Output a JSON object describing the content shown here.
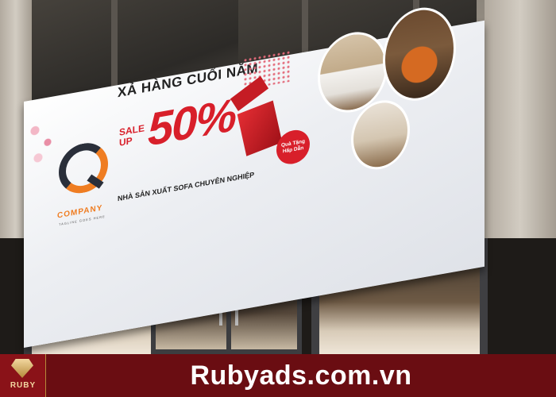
{
  "sign": {
    "headline": "XẢ HÀNG CUỐI NĂM",
    "sale_line1": "SALE",
    "sale_line2": "UP",
    "percent": "50%",
    "subline": "NHÀ SẢN XUẤT SOFA CHUYÊN NGHIỆP",
    "badge_line1": "Quà Tặng",
    "badge_line2": "Hấp Dẫn",
    "company": "COMPANY",
    "tagline": "TAGLINE GOES HERE"
  },
  "footer": {
    "brand": "RUBY",
    "domain": "Rubyads.com.vn"
  },
  "colors": {
    "accent_red": "#d81f2a",
    "logo_orange": "#ef7d22",
    "footer_bg": "#6a0d12"
  }
}
